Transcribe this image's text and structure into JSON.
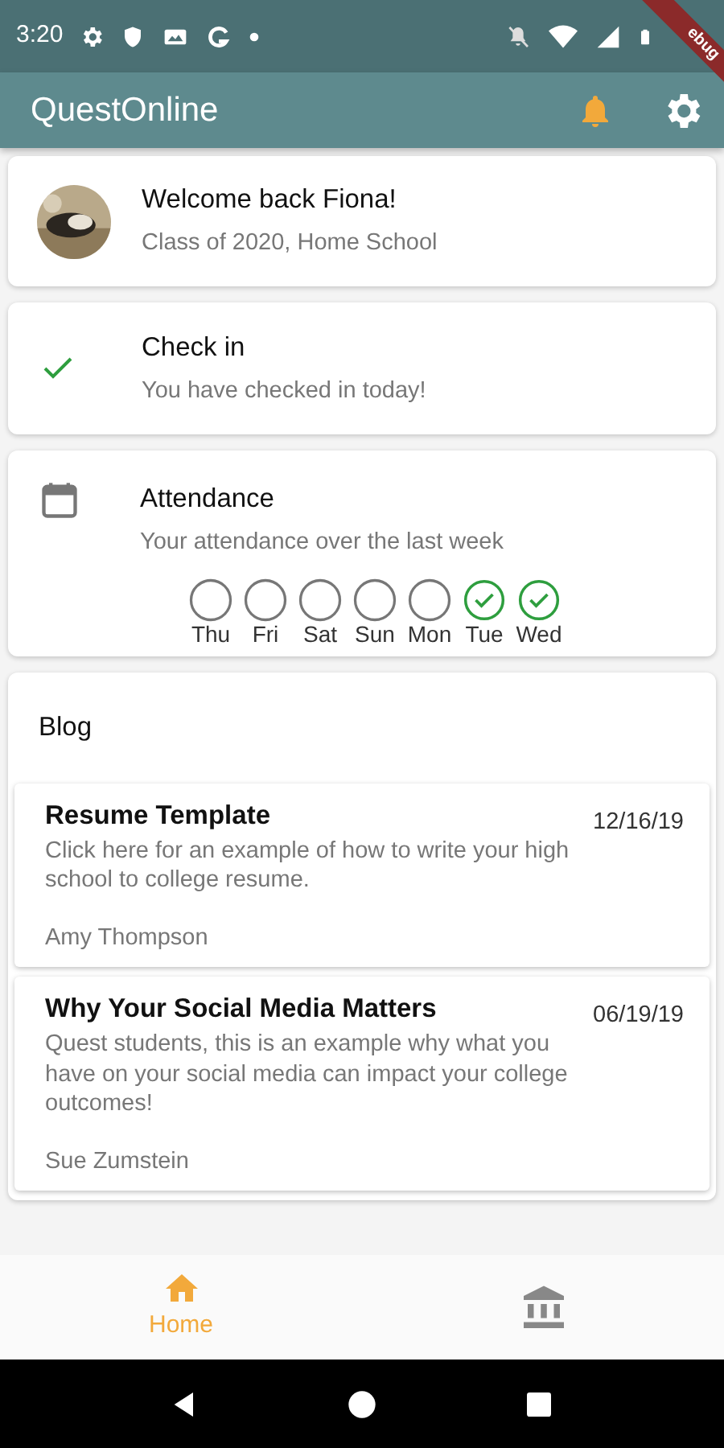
{
  "status_bar": {
    "time": "3:20"
  },
  "debug_banner": "ebug",
  "app_bar": {
    "title": "QuestOnline"
  },
  "profile": {
    "title": "Welcome back Fiona!",
    "subtitle": "Class of 2020, Home School"
  },
  "check_in": {
    "title": "Check in",
    "subtitle": "You have checked in today!",
    "checked": true
  },
  "attendance": {
    "title": "Attendance",
    "subtitle": "Your attendance over the last week",
    "days": [
      {
        "label": "Thu",
        "checked": false
      },
      {
        "label": "Fri",
        "checked": false
      },
      {
        "label": "Sat",
        "checked": false
      },
      {
        "label": "Sun",
        "checked": false
      },
      {
        "label": "Mon",
        "checked": false
      },
      {
        "label": "Tue",
        "checked": true
      },
      {
        "label": "Wed",
        "checked": true
      }
    ]
  },
  "blog": {
    "title": "Blog",
    "posts": [
      {
        "title": "Resume Template",
        "excerpt": "Click here for an example of how to write your high school to college resume.",
        "date": "12/16/19",
        "author": "Amy Thompson"
      },
      {
        "title": "Why Your Social Media Matters",
        "excerpt": "Quest students, this is an example why what you have on your social media can impact your college outcomes!",
        "date": "06/19/19",
        "author": "Sue Zumstein"
      }
    ]
  },
  "bottom_nav": [
    {
      "kind": "home",
      "label": "Home",
      "selected": true
    },
    {
      "kind": "school",
      "selected": false
    }
  ]
}
